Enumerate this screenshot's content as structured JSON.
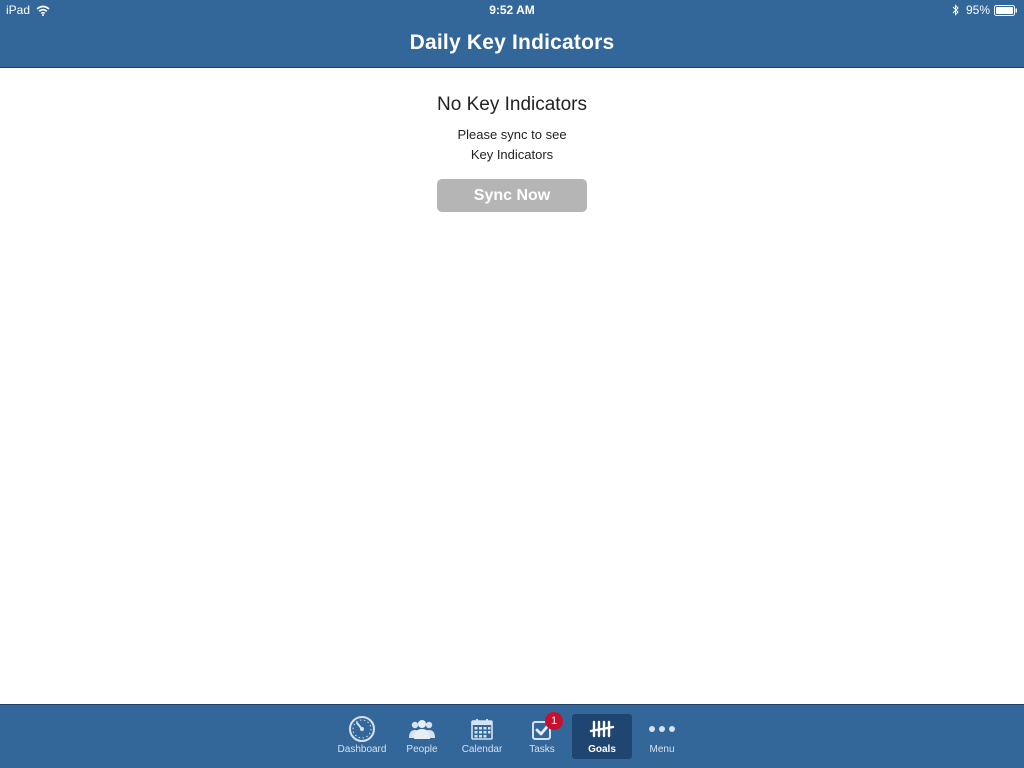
{
  "status_bar": {
    "device": "iPad",
    "time": "9:52 AM",
    "battery": "95%",
    "wifi_icon": "wifi-icon",
    "bluetooth_icon": "bluetooth-icon",
    "battery_icon": "battery-icon"
  },
  "nav": {
    "title": "Daily Key Indicators"
  },
  "empty_state": {
    "title": "No Key Indicators",
    "message_line1": "Please sync to see",
    "message_line2": "Key Indicators",
    "button_label": "Sync Now"
  },
  "tabbar": {
    "active": "Goals",
    "tabs": [
      {
        "label": "Dashboard",
        "icon": "gauge-icon"
      },
      {
        "label": "People",
        "icon": "people-icon"
      },
      {
        "label": "Calendar",
        "icon": "calendar-icon"
      },
      {
        "label": "Tasks",
        "icon": "checkbox-icon",
        "badge": "1"
      },
      {
        "label": "Goals",
        "icon": "tally-icon"
      },
      {
        "label": "Menu",
        "icon": "more-dots-icon"
      }
    ]
  },
  "colors": {
    "header_bg": "#336699",
    "active_tab_bg": "#1f4670",
    "button_disabled": "#b5b5b5",
    "badge": "#c8102e"
  }
}
